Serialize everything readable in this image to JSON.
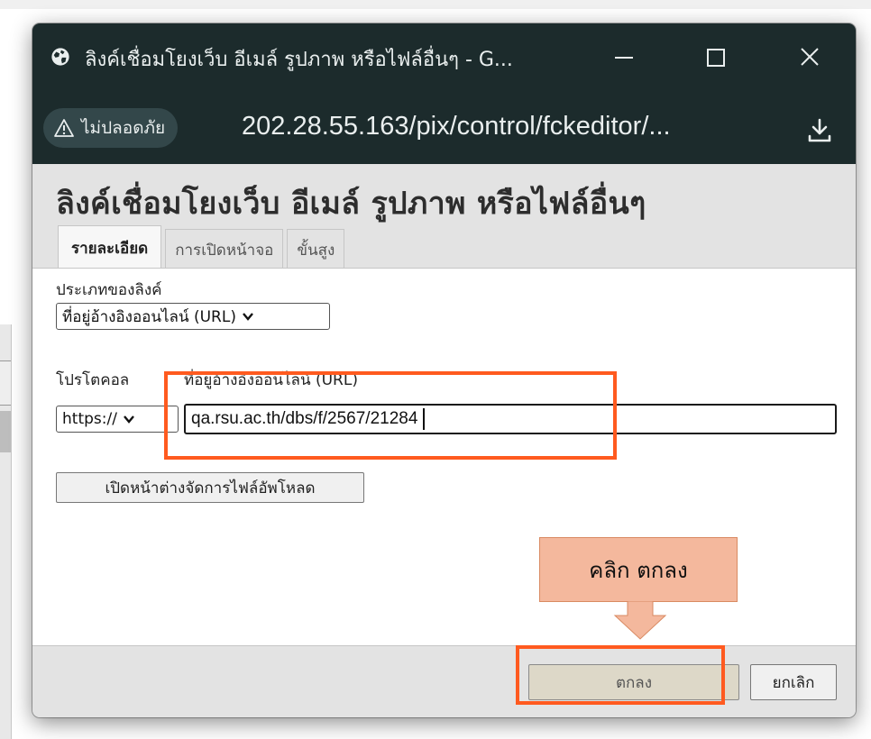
{
  "window": {
    "title": "ลิงค์เชื่อมโยงเว็บ อีเมล์ รูปภาพ หรือไฟล์อื่นๆ - G...",
    "controls": [
      "minimize-icon",
      "maximize-icon",
      "close-icon"
    ]
  },
  "addressbar": {
    "security_badge": "ไม่ปลอดภัย",
    "url": "202.28.55.163/pix/control/fckeditor/..."
  },
  "dialog": {
    "title": "ลิงค์เชื่อมโยงเว็บ อีเมล์ รูปภาพ หรือไฟล์อื่นๆ",
    "tabs": [
      {
        "label": "รายละเอียด",
        "active": true
      },
      {
        "label": "การเปิดหน้าจอ",
        "active": false
      },
      {
        "label": "ขั้นสูง",
        "active": false
      }
    ],
    "link_type": {
      "label": "ประเภทของลิงค์",
      "selected": "ที่อยู่อ้างอิงออนไลน์ (URL)"
    },
    "protocol": {
      "label": "โปรโตคอล",
      "selected": "https://"
    },
    "url_field": {
      "label": "ที่อยู่อ้างอิงออนไลน์ (URL)",
      "value": "qa.rsu.ac.th/dbs/f/2567/21284"
    },
    "browse_button": "เปิดหน้าต่างจัดการไฟล์อัพโหลด",
    "ok_button": "ตกลง",
    "cancel_button": "ยกเลิก"
  },
  "annotation": {
    "callout_text": "คลิก ตกลง",
    "color": "#ff5a1f"
  },
  "colors": {
    "titlebar": "#1c2b2c",
    "dialog_bg": "#e3e3e3",
    "callout_bg": "#f4b89d"
  }
}
